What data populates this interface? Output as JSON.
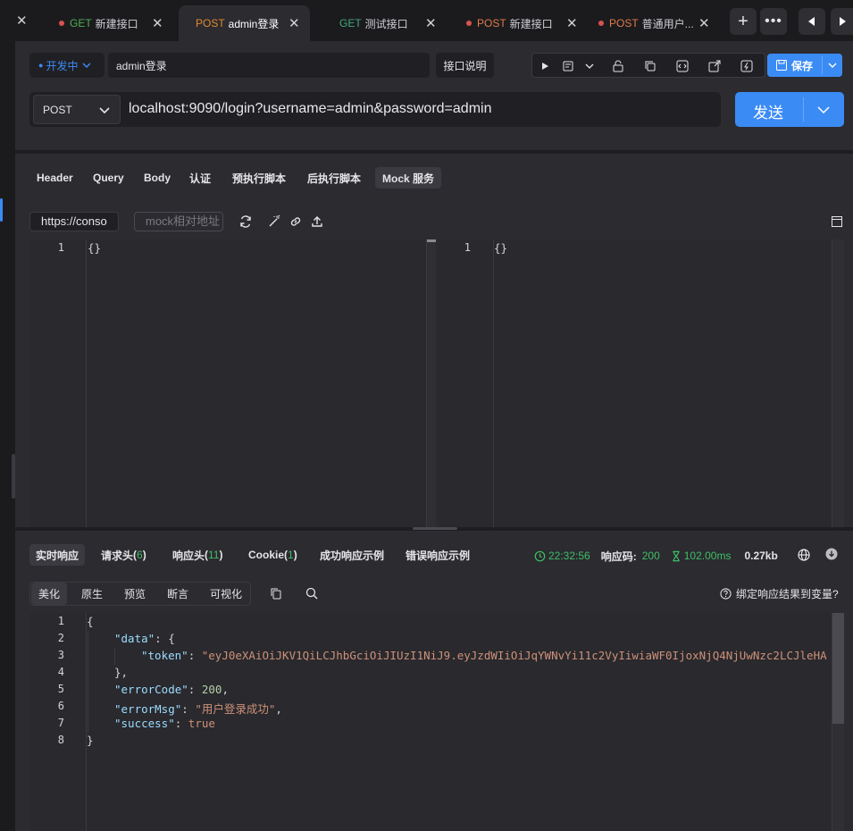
{
  "tabs": [
    {
      "method": "GET",
      "name": "新建接口",
      "dot": "#d9534f",
      "method_color": "#4caf50",
      "active": false
    },
    {
      "method": "POST",
      "name": "admin登录",
      "dot": "",
      "method_color": "#e08a2c",
      "active": true
    },
    {
      "method": "GET",
      "name": "测试接口",
      "dot": "",
      "method_color": "#3fa87a",
      "active": false
    },
    {
      "method": "POST",
      "name": "新建接口",
      "dot": "#d9534f",
      "method_color": "#e07b48",
      "active": false
    },
    {
      "method": "POST",
      "name": "普通用户...",
      "dot": "#d9534f",
      "method_color": "#e07b48",
      "active": false
    }
  ],
  "request": {
    "env_label": "开发中",
    "name": "admin登录",
    "doc_label": "接口说明",
    "save_label": "保存",
    "method": "POST",
    "url": "localhost:9090/login?username=admin&password=admin",
    "send_label": "发送"
  },
  "subtabs": [
    "Header",
    "Query",
    "Body",
    "认证",
    "预执行脚本",
    "后执行脚本",
    "Mock 服务"
  ],
  "mock": {
    "url_value": "https://conso",
    "path_placeholder": "mock相对地址",
    "left_editor": {
      "line": "1",
      "content": "{}"
    },
    "right_editor": {
      "line": "1",
      "content": "{}"
    }
  },
  "response_tabs": {
    "realtime": "实时响应",
    "req_headers": "请求头",
    "req_headers_count": "6",
    "resp_headers": "响应头",
    "resp_headers_count": "11",
    "cookie": "Cookie",
    "cookie_count": "1",
    "success_example": "成功响应示例",
    "error_example": "错误响应示例"
  },
  "response_meta": {
    "time": "22:32:56",
    "status_label": "响应码:",
    "status_code": "200",
    "duration": "102.00ms",
    "size": "0.27kb"
  },
  "view_tabs": [
    "美化",
    "原生",
    "预览",
    "断言",
    "可视化"
  ],
  "bind_label": "绑定响应结果到变量?",
  "response_lines": [
    "1",
    "2",
    "3",
    "4",
    "5",
    "6",
    "7",
    "8"
  ],
  "response_json": {
    "token_key": "\"token\"",
    "token_value": "\"eyJ0eXAiOiJKV1QiLCJhbGciOiJIUzI1NiJ9.eyJzdWIiOiJqYWNvYi11c2VyIiwiaWF0IjoxNjQ4NjUwNzc2LCJleHA",
    "data_key": "\"data\"",
    "errorCode_key": "\"errorCode\"",
    "errorCode_value": "200",
    "errorMsg_key": "\"errorMsg\"",
    "errorMsg_value": "\"用户登录成功\"",
    "success_key": "\"success\"",
    "success_value": "true"
  },
  "colors": {
    "accent": "#3b8bf5",
    "success": "#3fbf66"
  }
}
